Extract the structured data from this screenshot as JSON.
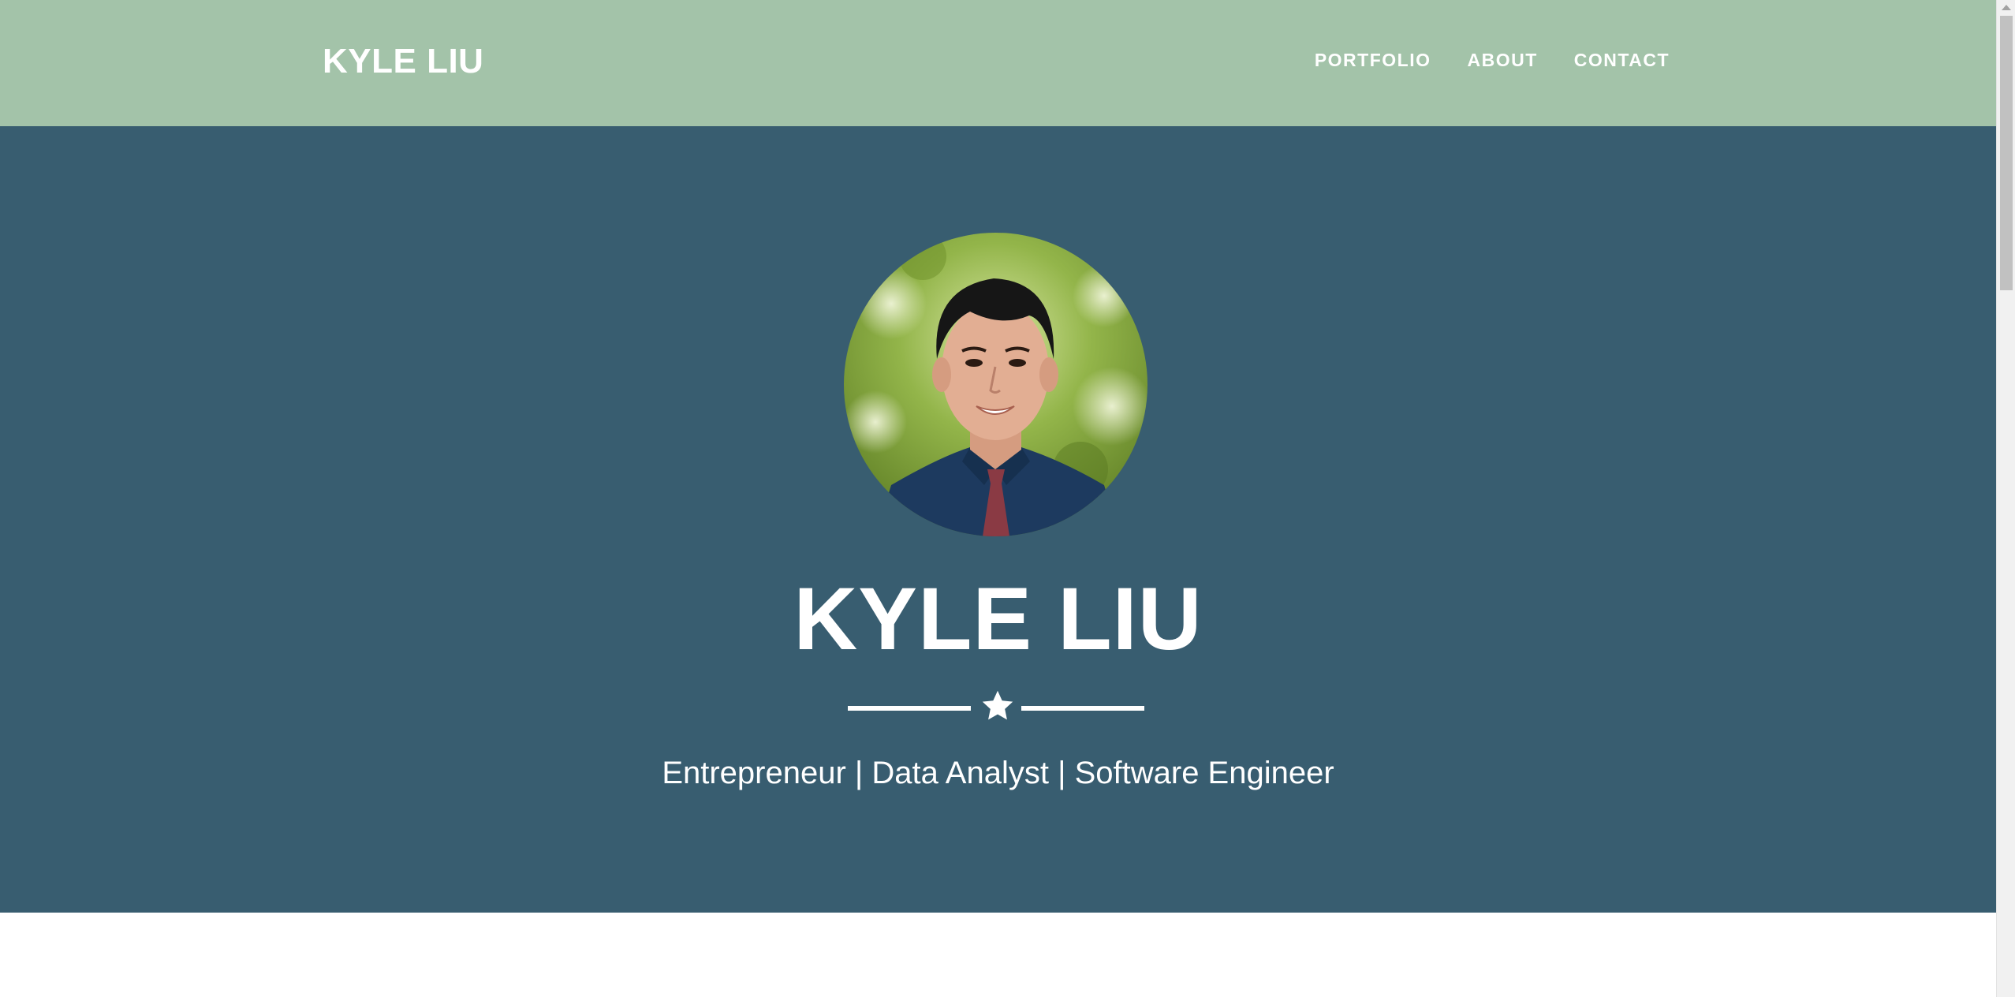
{
  "navbar": {
    "brand": "KYLE LIU",
    "links": [
      {
        "label": "PORTFOLIO"
      },
      {
        "label": "ABOUT"
      },
      {
        "label": "CONTACT"
      }
    ]
  },
  "hero": {
    "title": "KYLE LIU",
    "divider_icon": "star-icon",
    "tagline": "Entrepreneur | Data Analyst | Software Engineer"
  },
  "colors": {
    "navbar_bg": "#a3c3a9",
    "hero_bg": "#385d70",
    "text": "#ffffff"
  }
}
